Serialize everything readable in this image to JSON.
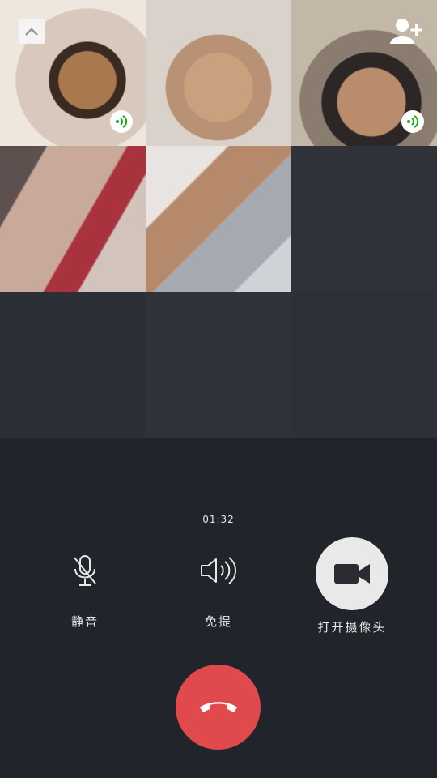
{
  "call": {
    "duration": "01:32"
  },
  "controls": {
    "mute_label": "静音",
    "speaker_label": "免提",
    "camera_label": "打开摄像头"
  },
  "icons": {
    "collapse": "chevron-up-icon",
    "add_member": "add-user-icon",
    "speaking": "speaking-icon",
    "mute": "microphone-off-icon",
    "speaker": "speaker-icon",
    "camera": "video-camera-icon",
    "hangup": "hang-up-icon"
  },
  "colors": {
    "background": "#21242a",
    "hangup": "#e04a4d",
    "speaking_indicator": "#1aad19",
    "camera_button": "#e9e9e9"
  }
}
